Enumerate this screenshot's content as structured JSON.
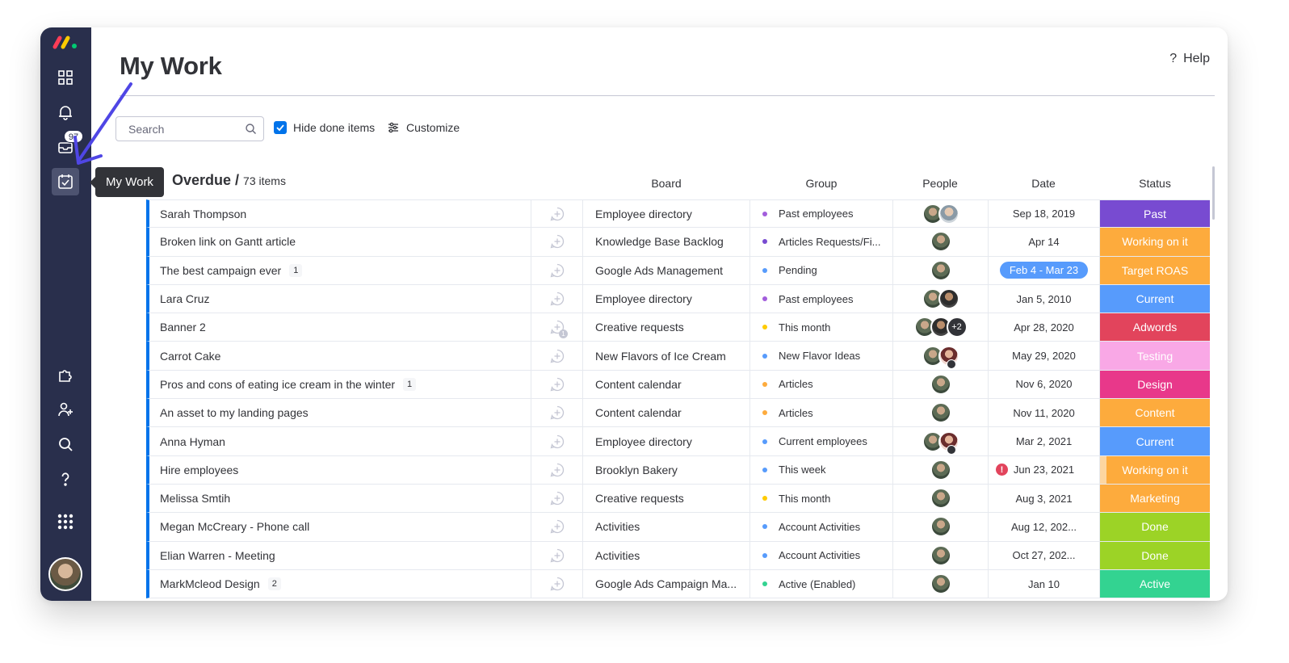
{
  "app": {
    "page_title": "My Work",
    "help_label": "Help",
    "help_icon_glyph": "?",
    "inbox_badge": "97",
    "tooltip": "My Work",
    "brand_colors": [
      "#ff3d57",
      "#ffcb00",
      "#00ca72"
    ]
  },
  "toolbar": {
    "search_placeholder": "Search",
    "hide_done_label": "Hide done items",
    "hide_done_checked": true,
    "customize_label": "Customize"
  },
  "group": {
    "title": "Overdue /",
    "count": "73 items"
  },
  "columns": {
    "board": "Board",
    "group": "Group",
    "people": "People",
    "date": "Date",
    "status": "Status"
  },
  "rows": [
    {
      "name": "Sarah Thompson",
      "sub": "",
      "board": "Employee directory",
      "group": "Past employees",
      "group_color": "#a25ddc",
      "people": [
        "woman",
        "man"
      ],
      "date": "Sep 18, 2019",
      "status": "Past",
      "status_color": "#784bd1",
      "date_style": "text"
    },
    {
      "name": "Broken link on Gantt article",
      "sub": "",
      "board": "Knowledge Base Backlog",
      "group": "Articles Requests/Fi...",
      "group_color": "#784bd1",
      "people": [
        "woman"
      ],
      "date": "Apr 14",
      "status": "Working on it",
      "status_color": "#fdab3d",
      "date_style": "text"
    },
    {
      "name": "The best campaign ever",
      "sub": "1",
      "board": "Google Ads Management",
      "group": "Pending",
      "group_color": "#579bfc",
      "people": [
        "woman"
      ],
      "date": "Feb 4 - Mar 23",
      "status": "Target ROAS",
      "status_color": "#fdab3d",
      "date_style": "range"
    },
    {
      "name": "Lara Cruz",
      "sub": "",
      "board": "Employee directory",
      "group": "Past employees",
      "group_color": "#a25ddc",
      "people": [
        "woman",
        "dark"
      ],
      "date": "Jan 5, 2010",
      "status": "Current",
      "status_color": "#579bfc",
      "date_style": "text"
    },
    {
      "name": "Banner 2",
      "sub": "",
      "board": "Creative requests",
      "group": "This month",
      "group_color": "#ffcb00",
      "people": [
        "woman",
        "dark",
        "plus"
      ],
      "plus_label": "+2",
      "date": "Apr 28, 2020",
      "status": "Adwords",
      "status_color": "#e2445c",
      "date_style": "text",
      "update_count": "1"
    },
    {
      "name": "Carrot Cake",
      "sub": "",
      "board": "New Flavors of Ice Cream",
      "group": "New Flavor Ideas",
      "group_color": "#579bfc",
      "people": [
        "woman",
        "pink"
      ],
      "date": "May 29, 2020",
      "status": "Testing",
      "status_color": "#f9a8e6",
      "date_style": "text"
    },
    {
      "name": "Pros and cons of eating ice cream in the winter",
      "sub": "1",
      "board": "Content calendar",
      "group": "Articles",
      "group_color": "#fdab3d",
      "people": [
        "woman"
      ],
      "date": "Nov 6, 2020",
      "status": "Design",
      "status_color": "#e8388a",
      "date_style": "text"
    },
    {
      "name": "An asset to my landing pages",
      "sub": "",
      "board": "Content calendar",
      "group": "Articles",
      "group_color": "#fdab3d",
      "people": [
        "woman"
      ],
      "date": "Nov 11, 2020",
      "status": "Content",
      "status_color": "#fdab3d",
      "date_style": "text"
    },
    {
      "name": "Anna Hyman",
      "sub": "",
      "board": "Employee directory",
      "group": "Current employees",
      "group_color": "#579bfc",
      "people": [
        "woman",
        "pink"
      ],
      "date": "Mar 2, 2021",
      "status": "Current",
      "status_color": "#579bfc",
      "date_style": "text"
    },
    {
      "name": "Hire employees",
      "sub": "",
      "board": "Brooklyn Bakery",
      "group": "This week",
      "group_color": "#579bfc",
      "people": [
        "woman"
      ],
      "date": "Jun 23, 2021",
      "status": "Working on it",
      "status_color": "#fdab3d",
      "date_style": "warn",
      "warn_glyph": "!"
    },
    {
      "name": "Melissa Smtih",
      "sub": "",
      "board": "Creative requests",
      "group": "This month",
      "group_color": "#ffcb00",
      "people": [
        "woman"
      ],
      "date": "Aug 3, 2021",
      "status": "Marketing",
      "status_color": "#fdab3d",
      "date_style": "text"
    },
    {
      "name": "Megan McCreary - Phone call",
      "sub": "",
      "board": "Activities",
      "group": "Account Activities",
      "group_color": "#579bfc",
      "people": [
        "woman"
      ],
      "date": "Aug 12, 202...",
      "status": "Done",
      "status_color": "#9cd326",
      "date_style": "text"
    },
    {
      "name": "Elian Warren - Meeting",
      "sub": "",
      "board": "Activities",
      "group": "Account Activities",
      "group_color": "#579bfc",
      "people": [
        "woman"
      ],
      "date": "Oct 27, 202...",
      "status": "Done",
      "status_color": "#9cd326",
      "date_style": "text"
    },
    {
      "name": "MarkMcleod Design",
      "sub": "2",
      "board": "Google Ads Campaign Ma...",
      "group": "Active (Enabled)",
      "group_color": "#33d391",
      "people": [
        "woman"
      ],
      "date": "Jan 10",
      "status": "Active",
      "status_color": "#33d391",
      "date_style": "text"
    }
  ]
}
